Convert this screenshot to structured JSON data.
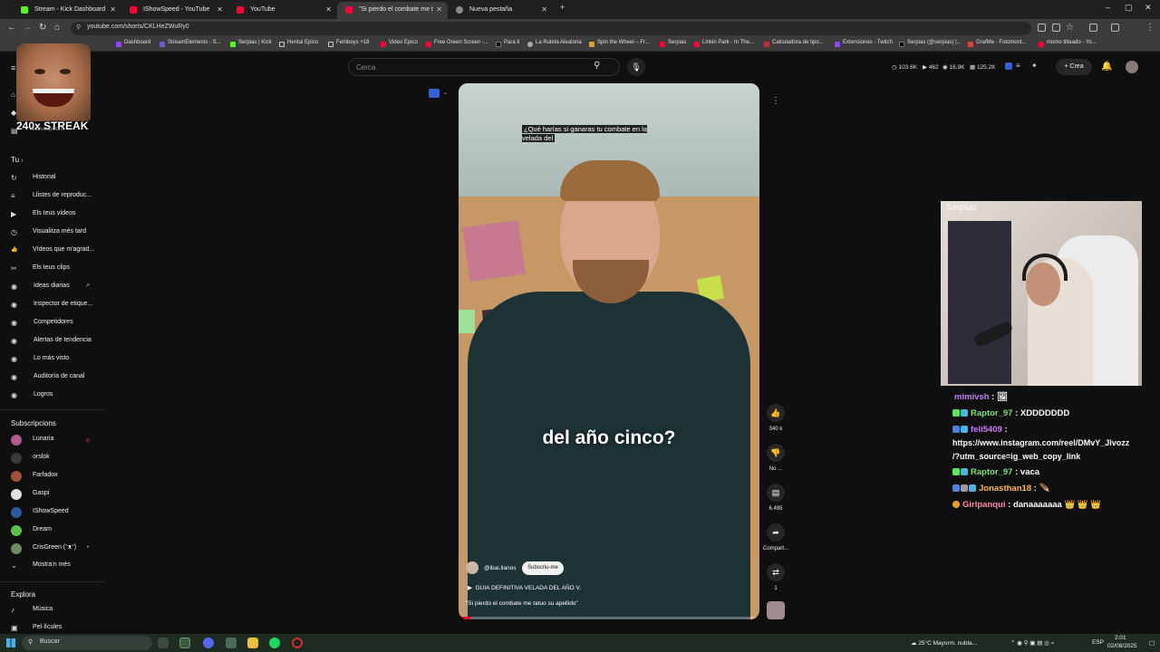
{
  "browser": {
    "tabs": [
      {
        "label": "Stream - Kick Dashboard",
        "color": "#53fc18"
      },
      {
        "label": "IShowSpeed - YouTube",
        "color": "#ff0033"
      },
      {
        "label": "YouTube",
        "color": "#ff0033"
      },
      {
        "label": "\"Si pierdo el combate me t",
        "color": "#ff0033"
      },
      {
        "label": "Nueva pestaña",
        "color": "#888888"
      }
    ],
    "url": "youtube.com/shorts/CKLHeZWuRy0",
    "bookmarks": [
      "Dashboard",
      "StreamElements - S...",
      "Serpias | Kick",
      "Hentai Epico",
      "Femboys +18",
      "Video Epico",
      "Free Green Screen -...",
      "Para ti",
      "La Ruleta Aleatoria",
      "Spin the Wheel – Fr...",
      "Serpias",
      "Linkin Park - In The...",
      "Calculadora de tipo...",
      "Extensiones - Twitch",
      "Serpias (@serpias) |...",
      "GrafMe - Fotomont...",
      "momo tilteado - Yo..."
    ]
  },
  "header": {
    "search_placeholder": "Cerca",
    "stats": [
      "103.6K",
      "462",
      "16.9K",
      "125.2K"
    ],
    "create_label": "Crea"
  },
  "overlay": {
    "streak_text": "240x STREAK",
    "hidden_item": "Subscripcions"
  },
  "sidebar": {
    "you_label": "Tu",
    "you_items": [
      {
        "icon": "history-icon",
        "glyph": "↻",
        "label": "Historial"
      },
      {
        "icon": "playlist-icon",
        "glyph": "≡",
        "label": "Llistes de reproduc..."
      },
      {
        "icon": "your-videos-icon",
        "glyph": "▶",
        "label": "Els teus vídeos"
      },
      {
        "icon": "watch-later-icon",
        "glyph": "◷",
        "label": "Visualitza més tard"
      },
      {
        "icon": "liked-icon",
        "glyph": "👍",
        "label": "Vídeos que m'agrad..."
      },
      {
        "icon": "clips-icon",
        "glyph": "✂",
        "label": "Els teus clips"
      },
      {
        "icon": "ideas-icon",
        "glyph": "◉",
        "label": "Ideas diarias"
      },
      {
        "icon": "tag-inspector-icon",
        "glyph": "◉",
        "label": "Inspector de etique..."
      },
      {
        "icon": "competitors-icon",
        "glyph": "◉",
        "label": "Competidores"
      },
      {
        "icon": "trend-alerts-icon",
        "glyph": "◉",
        "label": "Alertas de tendencia"
      },
      {
        "icon": "most-viewed-icon",
        "glyph": "◉",
        "label": "Lo más visto"
      },
      {
        "icon": "channel-audit-icon",
        "glyph": "◉",
        "label": "Auditoría de canal"
      },
      {
        "icon": "achievements-icon",
        "glyph": "◉",
        "label": "Logros"
      }
    ],
    "subs_label": "Subscripcions",
    "subs": [
      {
        "label": "Lunaria",
        "color": "#b25a8a"
      },
      {
        "label": "orslok",
        "color": "#3a3a3a"
      },
      {
        "label": "Farfadox",
        "color": "#a0503c"
      },
      {
        "label": "Gaspi",
        "color": "#e0e0e0"
      },
      {
        "label": "IShowSpeed",
        "color": "#2a5aa0"
      },
      {
        "label": "Dream",
        "color": "#5cbf4a"
      },
      {
        "label": "CrisGreen (ᵔᴥᵔ)",
        "color": "#6c8c5c"
      }
    ],
    "show_more": "Mostra'n més",
    "explore_label": "Explora",
    "explore_items": [
      {
        "icon": "music-icon",
        "glyph": "♪",
        "label": "Música"
      },
      {
        "icon": "movies-icon",
        "glyph": "▣",
        "label": "Pel·lícules"
      }
    ]
  },
  "short": {
    "caption_top": "¿Qué harías si ganaras tu combate en la velada del",
    "caption_main": "del año cinco?",
    "channel": "@ibai.llanos",
    "subscribe_label": "Subscriu-me",
    "playlist": "GUIA DEFINITIVA VELADA DEL AÑO V.",
    "title": "\"Si pierdo el combate me tatuo su apellido\"",
    "progress": 0.04,
    "likes": "340 k",
    "dislike_label": "No ...",
    "comments": "6.495",
    "share_label": "Compart...",
    "remix_count": "1"
  },
  "cam": {
    "tag": "Serpias"
  },
  "chat": [
    {
      "user": "mimivsh",
      "color": "#c77dff",
      "msg": " : 🖼",
      "badges": []
    },
    {
      "user": "Raptor_97",
      "color": "#7fe07f",
      "msg": " : XDDDDDDD",
      "badges": [
        "#5ce65c",
        "#4fb3e0"
      ]
    },
    {
      "user": "feli5409",
      "color": "#c77dff",
      "msg": " :",
      "badges": [
        "#4f7fe0",
        "#4fb3e0"
      ]
    },
    {
      "user": "",
      "color": "#ffffff",
      "msg": "https://www.instagram.com/reel/DMvY_Jlvozz",
      "badges": []
    },
    {
      "user": "",
      "color": "#ffffff",
      "msg": "/?utm_source=ig_web_copy_link",
      "badges": []
    },
    {
      "user": "Raptor_97",
      "color": "#7fe07f",
      "msg": " : vaca",
      "badges": [
        "#5ce65c",
        "#4fb3e0"
      ]
    },
    {
      "user": "Jonasthan18",
      "color": "#ffb84d",
      "msg": " : 🪶",
      "badges": [
        "#4f7fe0",
        "#999999",
        "#4fb3e0"
      ]
    },
    {
      "user": "Girlpanqui",
      "color": "#ff8aa8",
      "msg": " : danaaaaaaa 👑 👑 👑",
      "badges": [
        "#f0a020"
      ]
    }
  ],
  "taskbar": {
    "search_label": "Buscar",
    "weather": "25°C  Mayorm. nubla...",
    "lang": "ESP",
    "time": "2:01",
    "date": "02/08/2025"
  }
}
